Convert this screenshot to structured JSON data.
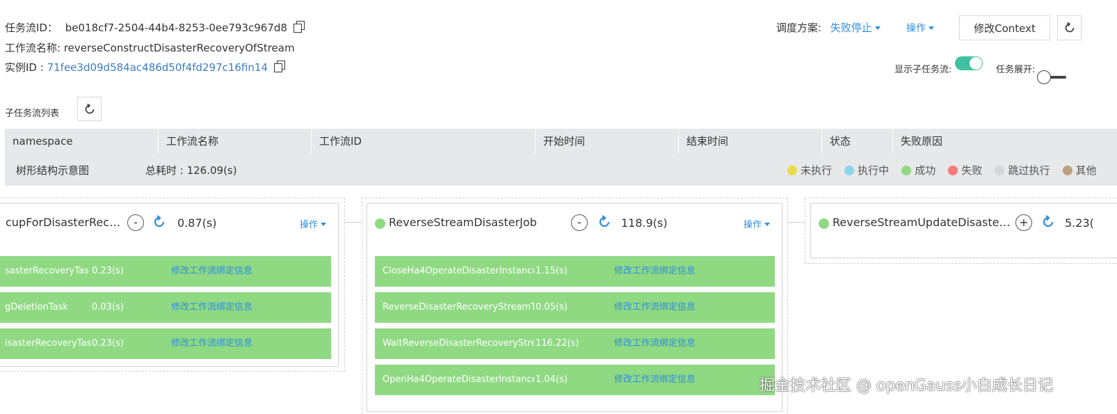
{
  "header": {
    "task_flow_id_label": "任务流ID：",
    "task_flow_id": "be018cf7-2504-44b4-8253-0ee793c967d8",
    "workflow_name_label": "工作流名称: ",
    "workflow_name": "reverseConstructDisasterRecoveryOfStream",
    "instance_id_label": "实例ID : ",
    "instance_id": "71fee3d09d584ac486d50f4fd297c16fin14"
  },
  "controls": {
    "schedule_label": "调度方案:",
    "schedule_value": "失败停止",
    "operation_label": "操作",
    "modify_context_label": "修改Context",
    "show_subflow_label": "显示子任务流:",
    "show_subflow_on": true,
    "task_expand_label": "任务展开:",
    "task_expand_on": false
  },
  "subflow": {
    "title": "子任务流列表",
    "columns": [
      "namespace",
      "工作流名称",
      "工作流ID",
      "开始时间",
      "结束时间",
      "状态",
      "失败原因"
    ]
  },
  "tree": {
    "title": "树形结构示意图",
    "total_time_label": "总耗时 : ",
    "total_time": "126.09(s)",
    "legend": [
      {
        "label": "未执行",
        "color": "#e8dc4a"
      },
      {
        "label": "执行中",
        "color": "#8ed3ef"
      },
      {
        "label": "成功",
        "color": "#8fd983"
      },
      {
        "label": "失败",
        "color": "#f87b7b"
      },
      {
        "label": "跳过执行",
        "color": "#d6d6d6"
      },
      {
        "label": "其他",
        "color": "#bb9f7e"
      }
    ]
  },
  "jobs": [
    {
      "name": "cupForDisasterRecov…",
      "toggle": "-",
      "duration": "0.87(s)",
      "op": "操作",
      "tasks": [
        {
          "name": "sasterRecoveryTask",
          "duration": "0.23(s)",
          "link": "修改工作流绑定信息"
        },
        {
          "name": "gDeletionTask",
          "duration": "0.03(s)",
          "link": "修改工作流绑定信息"
        },
        {
          "name": "isasterRecoveryTask",
          "duration": "0.23(s)",
          "link": "修改工作流绑定信息"
        }
      ]
    },
    {
      "name": "ReverseStreamDisasterJob",
      "toggle": "-",
      "duration": "118.9(s)",
      "op": "操作",
      "tasks": [
        {
          "name": "CloseHa4OperateDisasterInstance…",
          "duration": "1.15(s)",
          "link": "修改工作流绑定信息"
        },
        {
          "name": "ReverseDisasterRecoveryStreamT…",
          "duration": "0.05(s)",
          "link": "修改工作流绑定信息"
        },
        {
          "name": "WaitReverseDisasterRecoveryStre…",
          "duration": "116.22(s)",
          "link": "修改工作流绑定信息"
        },
        {
          "name": "OpenHa4OperateDisasterInstance…",
          "duration": "1.04(s)",
          "link": "修改工作流绑定信息"
        }
      ]
    },
    {
      "name": "ReverseStreamUpdateDisasterR…",
      "toggle": "+",
      "duration": "5.23(",
      "op": ""
    }
  ],
  "watermark": "掘金技术社区 @ openGauss小白成长日记"
}
